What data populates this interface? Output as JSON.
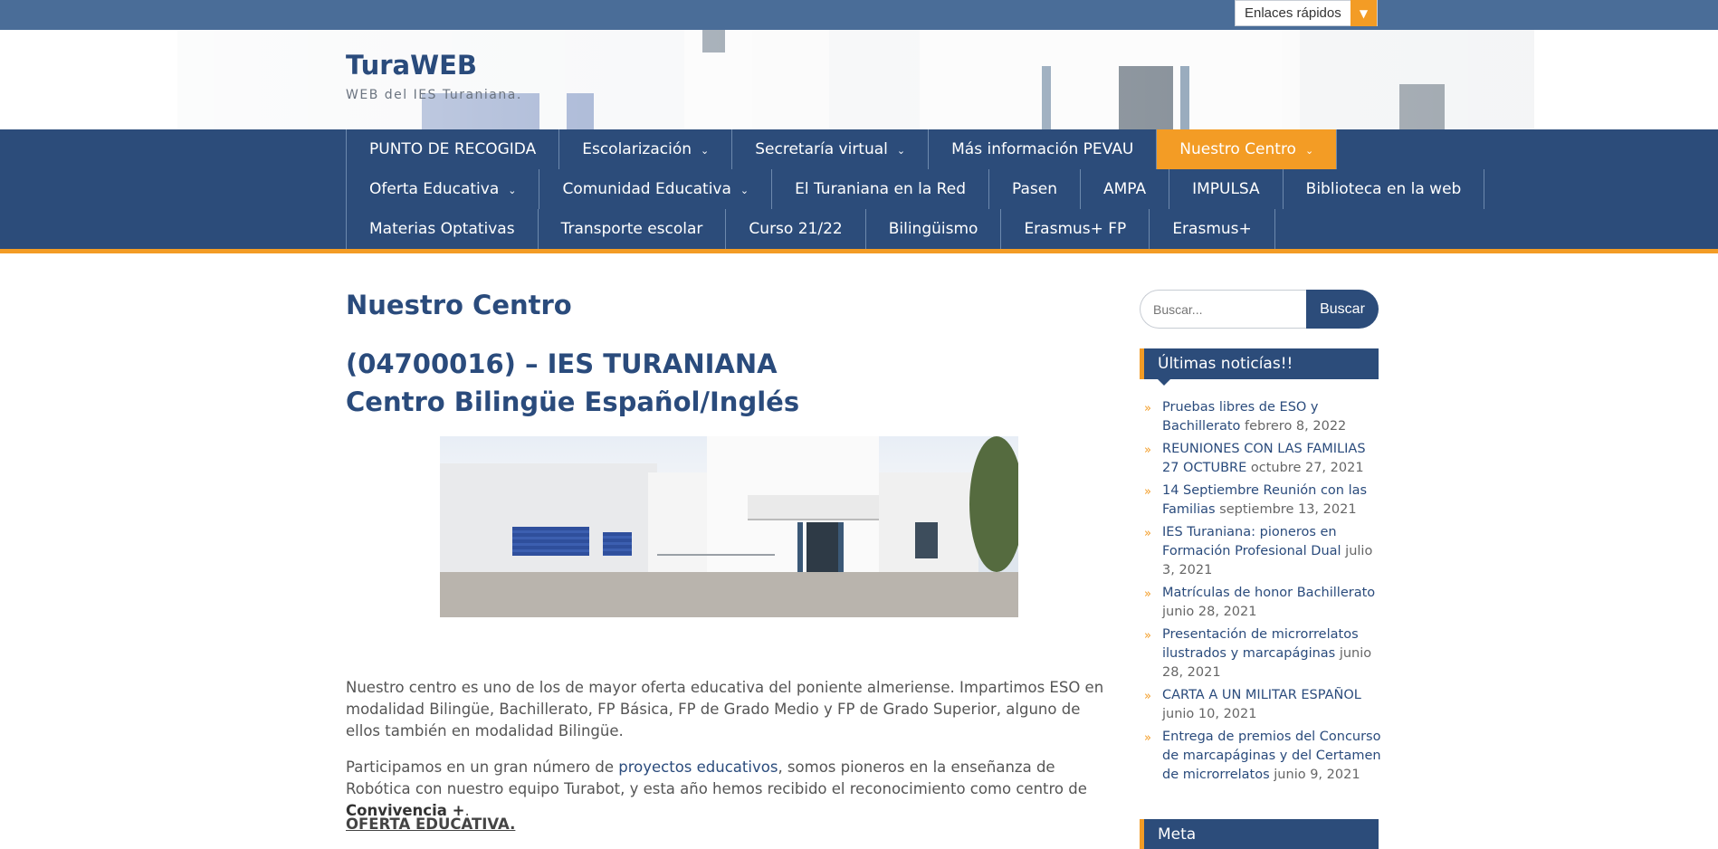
{
  "topbar": {
    "quick_links_label": "Enlaces rápidos"
  },
  "site": {
    "title": "TuraWEB",
    "description": "WEB del IES Turaniana."
  },
  "nav": {
    "row1": [
      {
        "label": "PUNTO DE RECOGIDA",
        "dropdown": false,
        "active": false
      },
      {
        "label": "Escolarización",
        "dropdown": true,
        "active": false
      },
      {
        "label": "Secretaría virtual",
        "dropdown": true,
        "active": false
      },
      {
        "label": "Más información PEVAU",
        "dropdown": false,
        "active": false
      },
      {
        "label": "Nuestro Centro",
        "dropdown": true,
        "active": true
      }
    ],
    "row2": [
      {
        "label": "Oferta Educativa",
        "dropdown": true,
        "active": false
      },
      {
        "label": "Comunidad Educativa",
        "dropdown": true,
        "active": false
      },
      {
        "label": "El Turaniana en la Red",
        "dropdown": false,
        "active": false
      },
      {
        "label": "Pasen",
        "dropdown": false,
        "active": false
      },
      {
        "label": "AMPA",
        "dropdown": false,
        "active": false
      },
      {
        "label": "IMPULSA",
        "dropdown": false,
        "active": false
      },
      {
        "label": "Biblioteca en la web",
        "dropdown": false,
        "active": false
      }
    ],
    "row3": [
      {
        "label": "Materias Optativas",
        "dropdown": false,
        "active": false
      },
      {
        "label": "Transporte escolar",
        "dropdown": false,
        "active": false
      },
      {
        "label": "Curso 21/22",
        "dropdown": false,
        "active": false
      },
      {
        "label": "Bilingüismo",
        "dropdown": false,
        "active": false
      },
      {
        "label": "Erasmus+ FP",
        "dropdown": false,
        "active": false
      },
      {
        "label": "Erasmus+",
        "dropdown": false,
        "active": false
      }
    ]
  },
  "main": {
    "page_title": "Nuestro Centro",
    "heading_code": "(04700016) – IES TURANIANA",
    "heading_subtitle": "Centro Bilingüe Español/Inglés",
    "para1": "Nuestro centro es uno de los de mayor oferta educativa del poniente almeriense. Impartimos ESO en modalidad Bilingüe, Bachillerato, FP Básica, FP de Grado Medio y FP de Grado Superior, alguno de ellos también en modalidad Bilingüe.",
    "para2_before": "Participamos en un gran número de ",
    "para2_link": "proyectos educativos",
    "para2_middle": ", somos pioneros en la enseñanza de Robótica con nuestro equipo Turabot, y esta año hemos recibido el reconocimiento como centro de ",
    "para2_bold": "Convivencia +",
    "para2_after": ".",
    "para3": "OFERTA EDUCATIVA."
  },
  "sidebar": {
    "search_placeholder": "Buscar...",
    "search_button": "Buscar",
    "news_title": "Últimas noticías!!",
    "news": [
      {
        "title": "Pruebas libres de ESO y Bachillerato",
        "date": "febrero 8, 2022"
      },
      {
        "title": "REUNIONES CON LAS FAMILIAS 27 OCTUBRE",
        "date": "octubre 27, 2021"
      },
      {
        "title": "14 Septiembre Reunión con las Familias",
        "date": "septiembre 13, 2021"
      },
      {
        "title": "IES Turaniana: pioneros en Formación Profesional Dual",
        "date": "julio 3, 2021"
      },
      {
        "title": "Matrículas de honor Bachillerato",
        "date": "junio 28, 2021"
      },
      {
        "title": "Presentación de microrrelatos ilustrados y marcapáginas",
        "date": "junio 28, 2021"
      },
      {
        "title": "CARTA A UN MILITAR ESPAÑOL",
        "date": "junio 10, 2021"
      },
      {
        "title": "Entrega de premios del Concurso de marcapáginas y del Certamen de microrrelatos",
        "date": "junio 9, 2021"
      }
    ],
    "meta_title": "Meta"
  },
  "colors": {
    "primary": "#2c4c7a",
    "accent": "#f39c25",
    "topbar": "#4a6d98"
  }
}
